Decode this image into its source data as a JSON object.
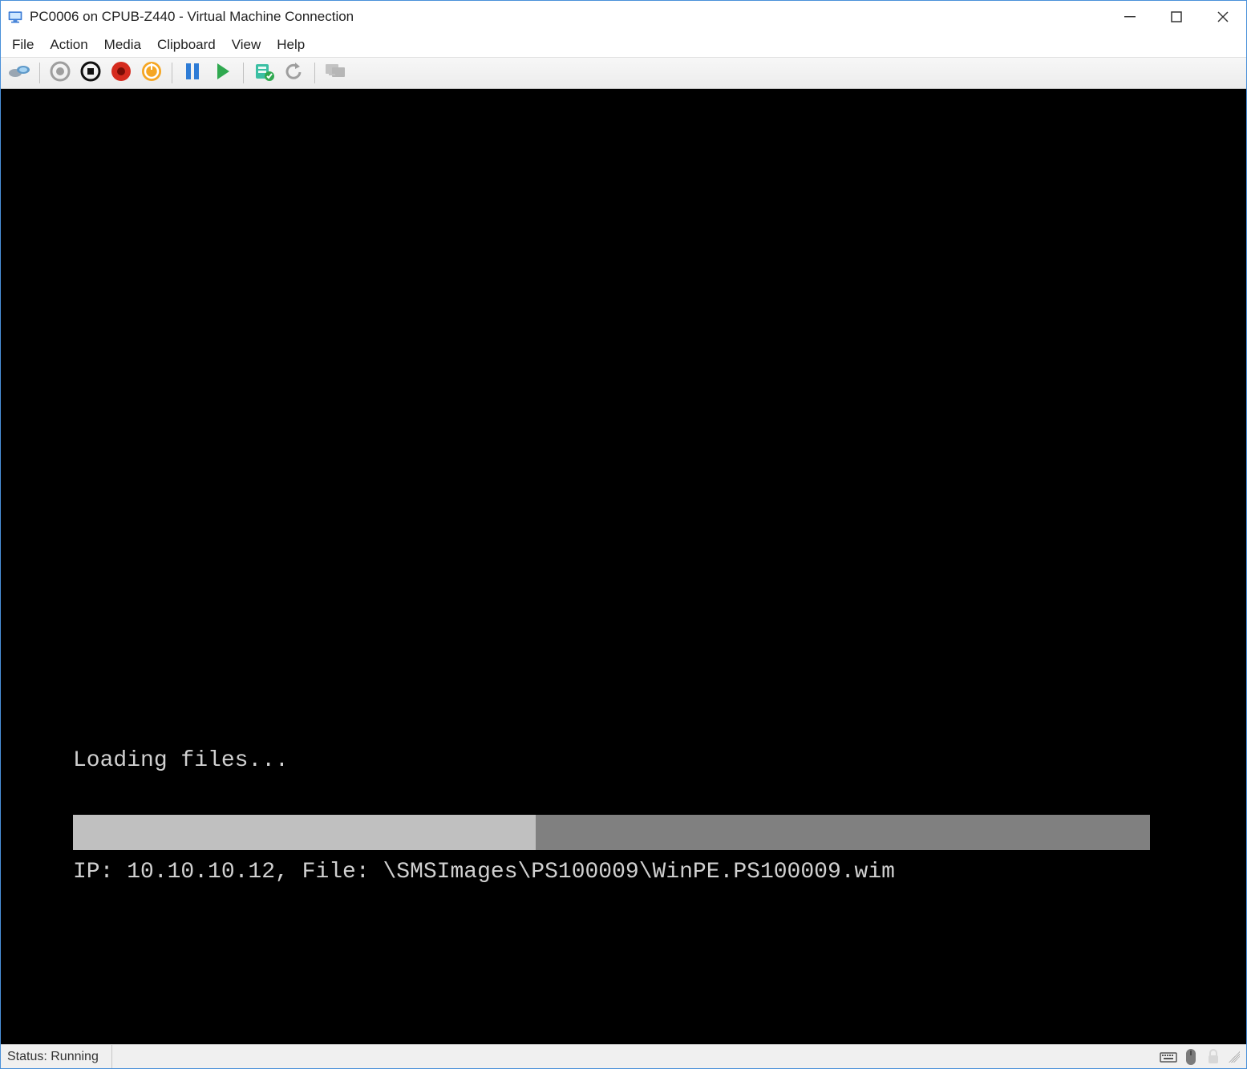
{
  "title": "PC0006 on CPUB-Z440 - Virtual Machine Connection",
  "menu": {
    "file": "File",
    "action": "Action",
    "media": "Media",
    "clipboard": "Clipboard",
    "view": "View",
    "help": "Help"
  },
  "toolbar": {
    "ctrl_alt_del": "ctrl-alt-del-icon",
    "turn_off": "turn-off-icon",
    "shutdown": "shutdown-icon",
    "save": "save-state-icon",
    "reset": "reset-icon",
    "pause": "pause-icon",
    "start": "start-icon",
    "checkpoint": "checkpoint-icon",
    "revert": "revert-icon",
    "enhanced": "enhanced-session-icon"
  },
  "vm": {
    "loading_label": "Loading files...",
    "progress_percent": 43,
    "detail_line": "IP: 10.10.10.12, File: \\SMSImages\\PS100009\\WinPE.PS100009.wim"
  },
  "status": {
    "text": "Status: Running"
  }
}
